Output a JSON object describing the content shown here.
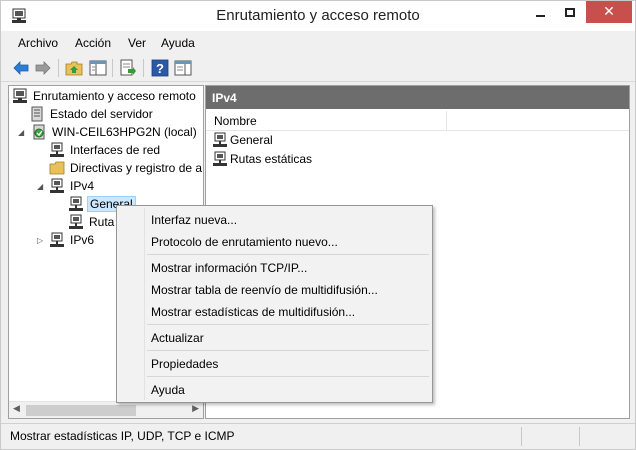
{
  "window": {
    "title": "Enrutamiento y acceso remoto",
    "close_glyph": "✕"
  },
  "menubar": {
    "items": [
      "Archivo",
      "Acción",
      "Ver",
      "Ayuda"
    ]
  },
  "toolbar": {
    "icons": [
      "back-arrow-icon",
      "forward-arrow-icon",
      "up-folder-icon",
      "show-hide-tree-icon",
      "export-list-icon",
      "help-icon",
      "properties-pane-icon"
    ]
  },
  "tree": {
    "items": [
      {
        "label": "Enrutamiento y acceso remoto",
        "icon": "computer-icon"
      },
      {
        "label": "Estado del servidor",
        "icon": "server-icon"
      },
      {
        "label": "WIN-CEIL63HPG2N (local)",
        "icon": "server-green-icon"
      },
      {
        "label": "Interfaces de red",
        "icon": "network-icon"
      },
      {
        "label": "Directivas y registro de a",
        "icon": "folder-icon"
      },
      {
        "label": "IPv4",
        "icon": "network-icon"
      },
      {
        "label": "General",
        "icon": "network-icon"
      },
      {
        "label": "Ruta",
        "icon": "network-icon"
      },
      {
        "label": "IPv6",
        "icon": "network-icon"
      }
    ],
    "expand_glyphs": {
      "expanded": "◢",
      "collapsed": "▷"
    }
  },
  "scroll": {
    "left": "◀",
    "right": "▶"
  },
  "right_pane": {
    "header": "IPv4",
    "column": "Nombre",
    "rows": [
      "General",
      "Rutas estáticas"
    ]
  },
  "context_menu": {
    "items": [
      "Interfaz nueva...",
      "Protocolo de enrutamiento nuevo...",
      "Mostrar información TCP/IP...",
      "Mostrar tabla de reenvío de multidifusión...",
      "Mostrar estadísticas de multidifusión...",
      "Actualizar",
      "Propiedades",
      "Ayuda"
    ]
  },
  "status": {
    "text": "Mostrar estadísticas IP, UDP, TCP e ICMP"
  },
  "colors": {
    "close_button": "#c7504d",
    "pane_header": "#6d6d6d",
    "selection": "#cce8ff",
    "toolbar_arrow": "#2d7dd2"
  }
}
